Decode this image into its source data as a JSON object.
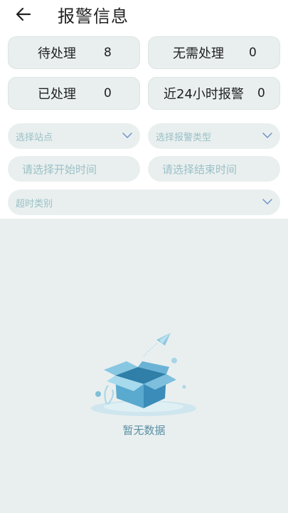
{
  "header": {
    "title": "报警信息"
  },
  "stats": [
    {
      "label": "待处理",
      "value": "8"
    },
    {
      "label": "无需处理",
      "value": "0"
    },
    {
      "label": "已处理",
      "value": "0"
    },
    {
      "label": "近24小时报警",
      "value": "0"
    }
  ],
  "filters": {
    "station_placeholder": "选择站点",
    "alarm_type_placeholder": "选择报警类型",
    "start_time_placeholder": "请选择开始时间",
    "end_time_placeholder": "请选择结束时间",
    "timeout_type_placeholder": "超时类别"
  },
  "empty": {
    "text": "暂无数据"
  },
  "colors": {
    "card_bg": "#e9efef",
    "placeholder": "#9bc0c6",
    "chevron": "#6f93c8",
    "empty_text": "#5a8fa4"
  }
}
